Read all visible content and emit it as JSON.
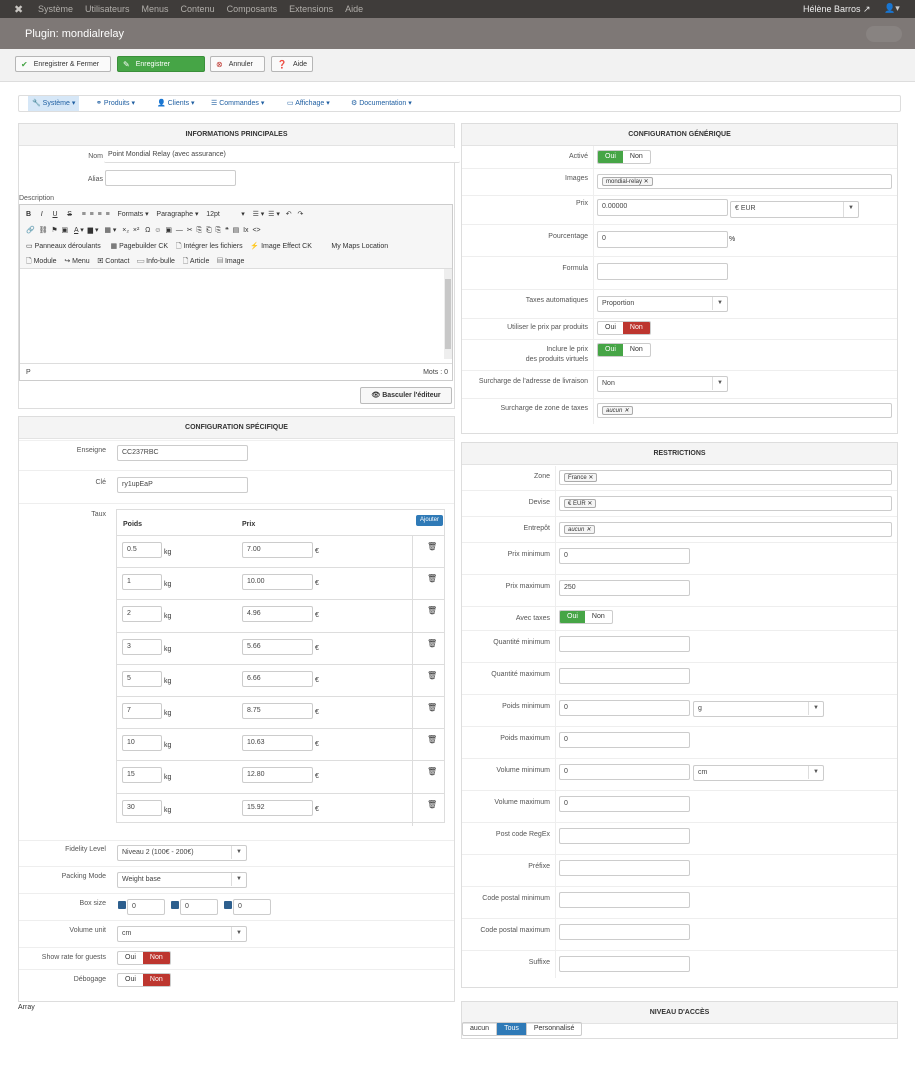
{
  "topnav": {
    "menus": [
      "Système",
      "Utilisateurs",
      "Menus",
      "Contenu",
      "Composants",
      "Extensions",
      "Aide"
    ],
    "user": "Hélène Barros",
    "user_icon": "▲"
  },
  "title": "Plugin: mondialrelay",
  "toolbar": {
    "save_close": "Enregistrer & Fermer",
    "save": "Enregistrer",
    "cancel": "Annuler",
    "help": "Aide"
  },
  "subnav": {
    "items": [
      "Système",
      "Produits",
      "Clients",
      "Commandes",
      "Affichage",
      "Documentation"
    ]
  },
  "main_info": {
    "header": "INFORMATIONS PRINCIPALES",
    "nom_label": "Nom",
    "nom_value": "Point Mondial Relay (avec assurance)",
    "alias_label": "Alias",
    "alias_value": "",
    "description_label": "Description",
    "editor": {
      "row1": [
        "B",
        "I",
        "U",
        "S",
        "Formats",
        "Paragraphe",
        "12pt"
      ],
      "row3": [
        "Panneaux déroulants",
        "Pagebuilder CK",
        "Intégrer les fichiers",
        "Image Effect CK",
        "My Maps Location"
      ],
      "row4": [
        "Module",
        "Menu",
        "Contact",
        "Info-bulle",
        "Article",
        "Image"
      ],
      "status_left": "P",
      "status_right": "Mots : 0"
    },
    "toggle_editor": "Basculer l'éditeur"
  },
  "specific": {
    "header": "CONFIGURATION SPÉCIFIQUE",
    "enseigne_label": "Enseigne",
    "enseigne_value": "CC237RBC",
    "cle_label": "Clé",
    "cle_value": "ry1upEaP",
    "taux_label": "Taux",
    "col_poids": "Poids",
    "col_prix": "Prix",
    "add_button": "Ajouter",
    "unit_kg": "kg",
    "unit_eur": "€",
    "rates": [
      {
        "w": "0.5",
        "p": "7.00"
      },
      {
        "w": "1",
        "p": "10.00"
      },
      {
        "w": "2",
        "p": "4.96"
      },
      {
        "w": "3",
        "p": "5.66"
      },
      {
        "w": "5",
        "p": "6.66"
      },
      {
        "w": "7",
        "p": "8.75"
      },
      {
        "w": "10",
        "p": "10.63"
      },
      {
        "w": "15",
        "p": "12.80"
      },
      {
        "w": "30",
        "p": "15.92"
      }
    ],
    "fidelity_label": "Fidelity Level",
    "fidelity_value": "Niveau 2 (100€ - 200€)",
    "packing_label": "Packing Mode",
    "packing_value": "Weight base",
    "boxsize_label": "Box size",
    "box_values": [
      "0",
      "0",
      "0"
    ],
    "volume_label": "Volume unit",
    "volume_value": "cm",
    "guests_label": "Show rate for guests",
    "debug_label": "Débogage",
    "oui": "Oui",
    "non": "Non"
  },
  "array_text": "Array",
  "generic": {
    "header": "CONFIGURATION GÉNÉRIQUE",
    "active_label": "Activé",
    "images_label": "Images",
    "images_tag": "mondial-relay",
    "prix_label": "Prix",
    "prix_value": "0.00000",
    "currency": "€ EUR",
    "pct_label": "Pourcentage",
    "pct_value": "0",
    "pct_unit": "%",
    "formula_label": "Formula",
    "taxes_label": "Taxes automatiques",
    "taxes_value": "Proportion",
    "use_price_label": "Utiliser le prix par produits",
    "virtual_label_1": "Inclure le prix",
    "virtual_label_2": "des produits virtuels",
    "surcharge_addr_label": "Surcharge de l'adresse de livraison",
    "surcharge_addr_value": "Non",
    "surcharge_zone_label": "Surcharge de zone de taxes",
    "surcharge_zone_tag": "aucun"
  },
  "restrictions": {
    "header": "RESTRICTIONS",
    "zone_label": "Zone",
    "zone_tag": "France",
    "devise_label": "Devise",
    "devise_tag": "€ EUR",
    "entrepot_label": "Entrepôt",
    "entrepot_tag": "aucun",
    "prix_min_label": "Prix minimum",
    "prix_min": "0",
    "prix_max_label": "Prix maximum",
    "prix_max": "250",
    "avec_taxes_label": "Avec taxes",
    "qmin_label": "Quantité minimum",
    "qmax_label": "Quantité maximum",
    "pmin_label": "Poids minimum",
    "pmin": "0",
    "pmin_unit": "g",
    "pmax_label": "Poids maximum",
    "pmax": "0",
    "vmin_label": "Volume minimum",
    "vmin": "0",
    "vmin_unit": "cm",
    "vmax_label": "Volume maximum",
    "vmax": "0",
    "regex_label": "Post code RegEx",
    "prefixe_label": "Préfixe",
    "cpmin_label": "Code postal minimum",
    "cpmax_label": "Code postal maximum",
    "suffixe_label": "Suffixe"
  },
  "access": {
    "header": "NIVEAU D'ACCÈS",
    "options": [
      "aucun",
      "Tous",
      "Personnalisé"
    ]
  }
}
